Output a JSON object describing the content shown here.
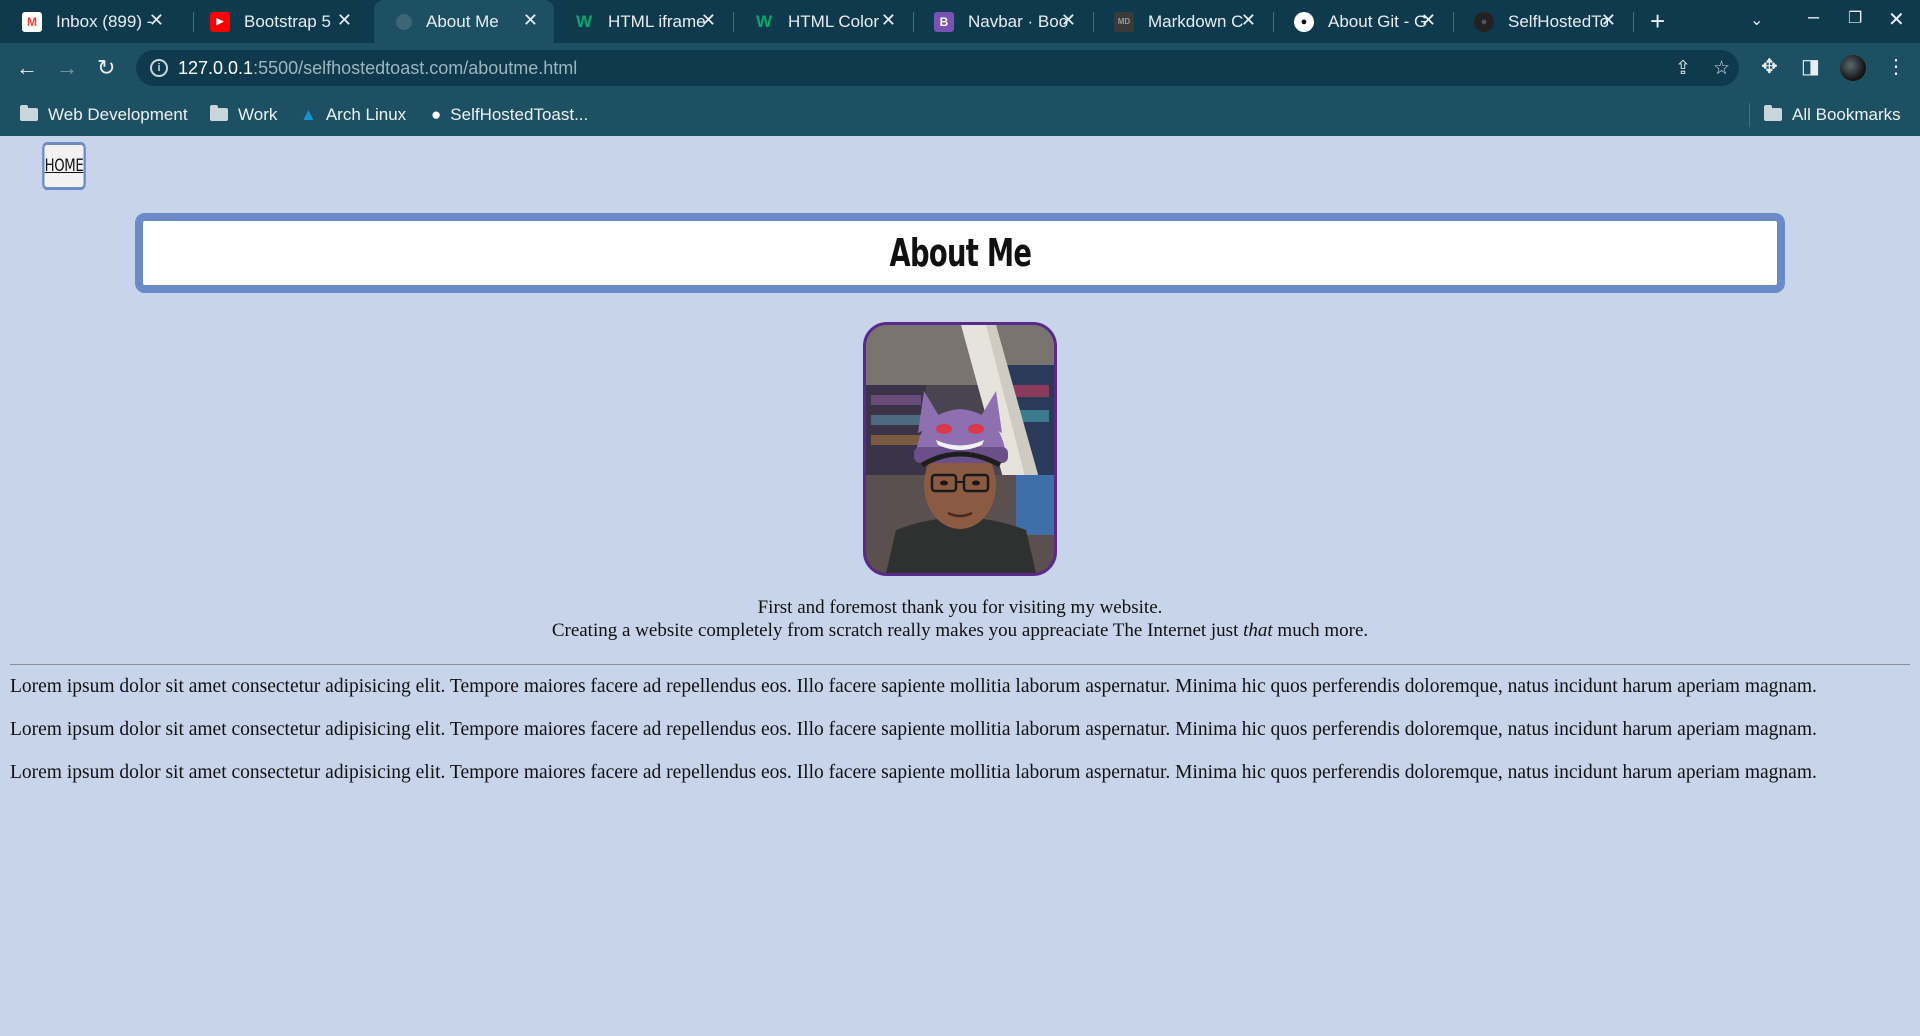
{
  "browser": {
    "tabs": [
      {
        "title": "Inbox (899) -",
        "icon": "gmail-icon",
        "color": "#ea4335"
      },
      {
        "title": "Bootstrap 5",
        "icon": "youtube-icon",
        "color": "#ff0000"
      },
      {
        "title": "About Me",
        "icon": "globe-icon",
        "color": "#7d98a3",
        "active": true
      },
      {
        "title": "HTML iframe",
        "icon": "w3schools-icon",
        "color": "#04aa6d"
      },
      {
        "title": "HTML Color",
        "icon": "w3schools-icon",
        "color": "#04aa6d"
      },
      {
        "title": "Navbar · Boo",
        "icon": "bootstrap-icon",
        "color": "#7952b3"
      },
      {
        "title": "Markdown C",
        "icon": "markdown-icon",
        "color": "#555555"
      },
      {
        "title": "About Git - G",
        "icon": "github-icon",
        "color": "#ffffff"
      },
      {
        "title": "SelfHostedTo",
        "icon": "github-icon",
        "color": "#222222"
      }
    ],
    "url_host": "127.0.0.1",
    "url_rest": ":5500/selfhostedtoast.com/aboutme.html",
    "bookmarks": [
      {
        "label": "Web Development",
        "icon": "folder-icon"
      },
      {
        "label": "Work",
        "icon": "folder-icon"
      },
      {
        "label": "Arch Linux",
        "icon": "arch-linux-icon"
      },
      {
        "label": "SelfHostedToast...",
        "icon": "github-icon"
      }
    ],
    "all_bookmarks": "All Bookmarks"
  },
  "page": {
    "home_label": "HOME",
    "title": "About Me",
    "intro_line1": "First and foremost thank you for visiting my website.",
    "intro_line2_before": "Creating a website completely from scratch really makes you appreaciate The Internet just ",
    "intro_line2_em": "that",
    "intro_line2_after": " much more.",
    "paragraphs": [
      "Lorem ipsum dolor sit amet consectetur adipisicing elit. Tempore maiores facere ad repellendus eos. Illo facere sapiente mollitia laborum aspernatur. Minima hic quos perferendis doloremque, natus incidunt harum aperiam magnam.",
      "Lorem ipsum dolor sit amet consectetur adipisicing elit. Tempore maiores facere ad repellendus eos. Illo facere sapiente mollitia laborum aspernatur. Minima hic quos perferendis doloremque, natus incidunt harum aperiam magnam.",
      "Lorem ipsum dolor sit amet consectetur adipisicing elit. Tempore maiores facere ad repellendus eos. Illo facere sapiente mollitia laborum aspernatur. Minima hic quos perferendis doloremque, natus incidunt harum aperiam magnam."
    ]
  }
}
